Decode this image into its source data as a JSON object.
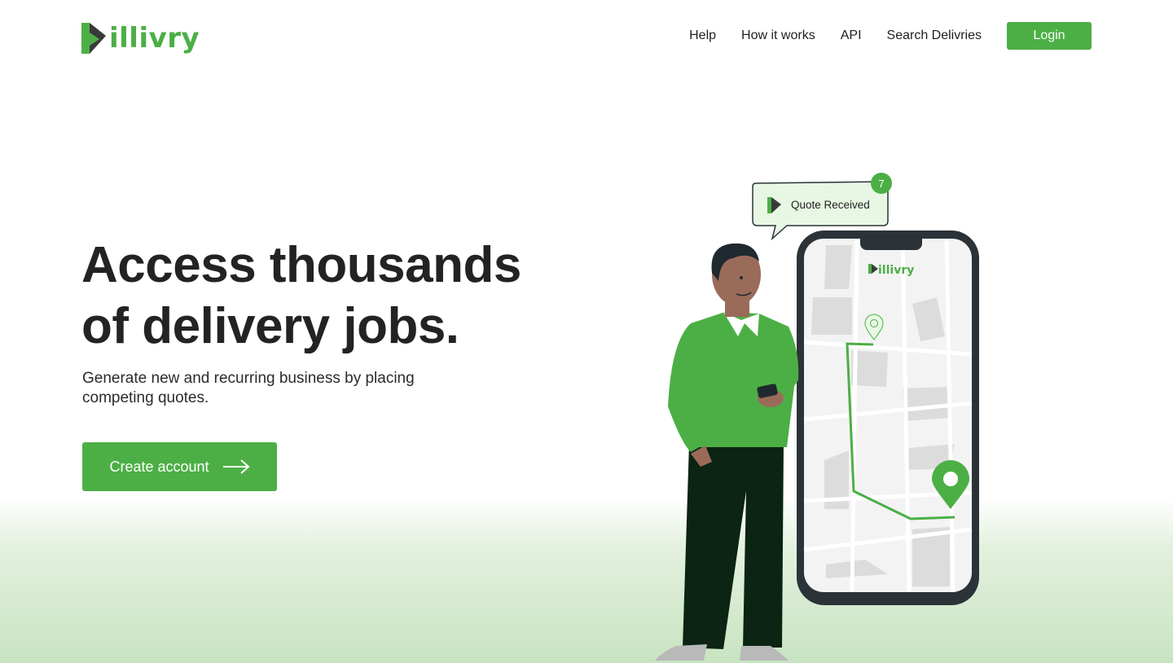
{
  "brand": {
    "name": "illivry",
    "accent": "#4caf45"
  },
  "nav": {
    "links": [
      "Help",
      "How it works",
      "API",
      "Search Delivries"
    ],
    "login_label": "Login"
  },
  "hero": {
    "title_line1": "Access thousands",
    "title_line2": "of delivery jobs.",
    "subtitle": "Generate new and recurring business by placing competing quotes.",
    "cta_label": "Create account",
    "cta_icon": "arrow-right-icon"
  },
  "illustration": {
    "notification_text": "Quote Received",
    "notification_count": "7",
    "phone_brand": "illivry",
    "colors": {
      "green": "#4caf45",
      "dark": "#2b3338",
      "map_bg": "#f2f2f2"
    }
  }
}
